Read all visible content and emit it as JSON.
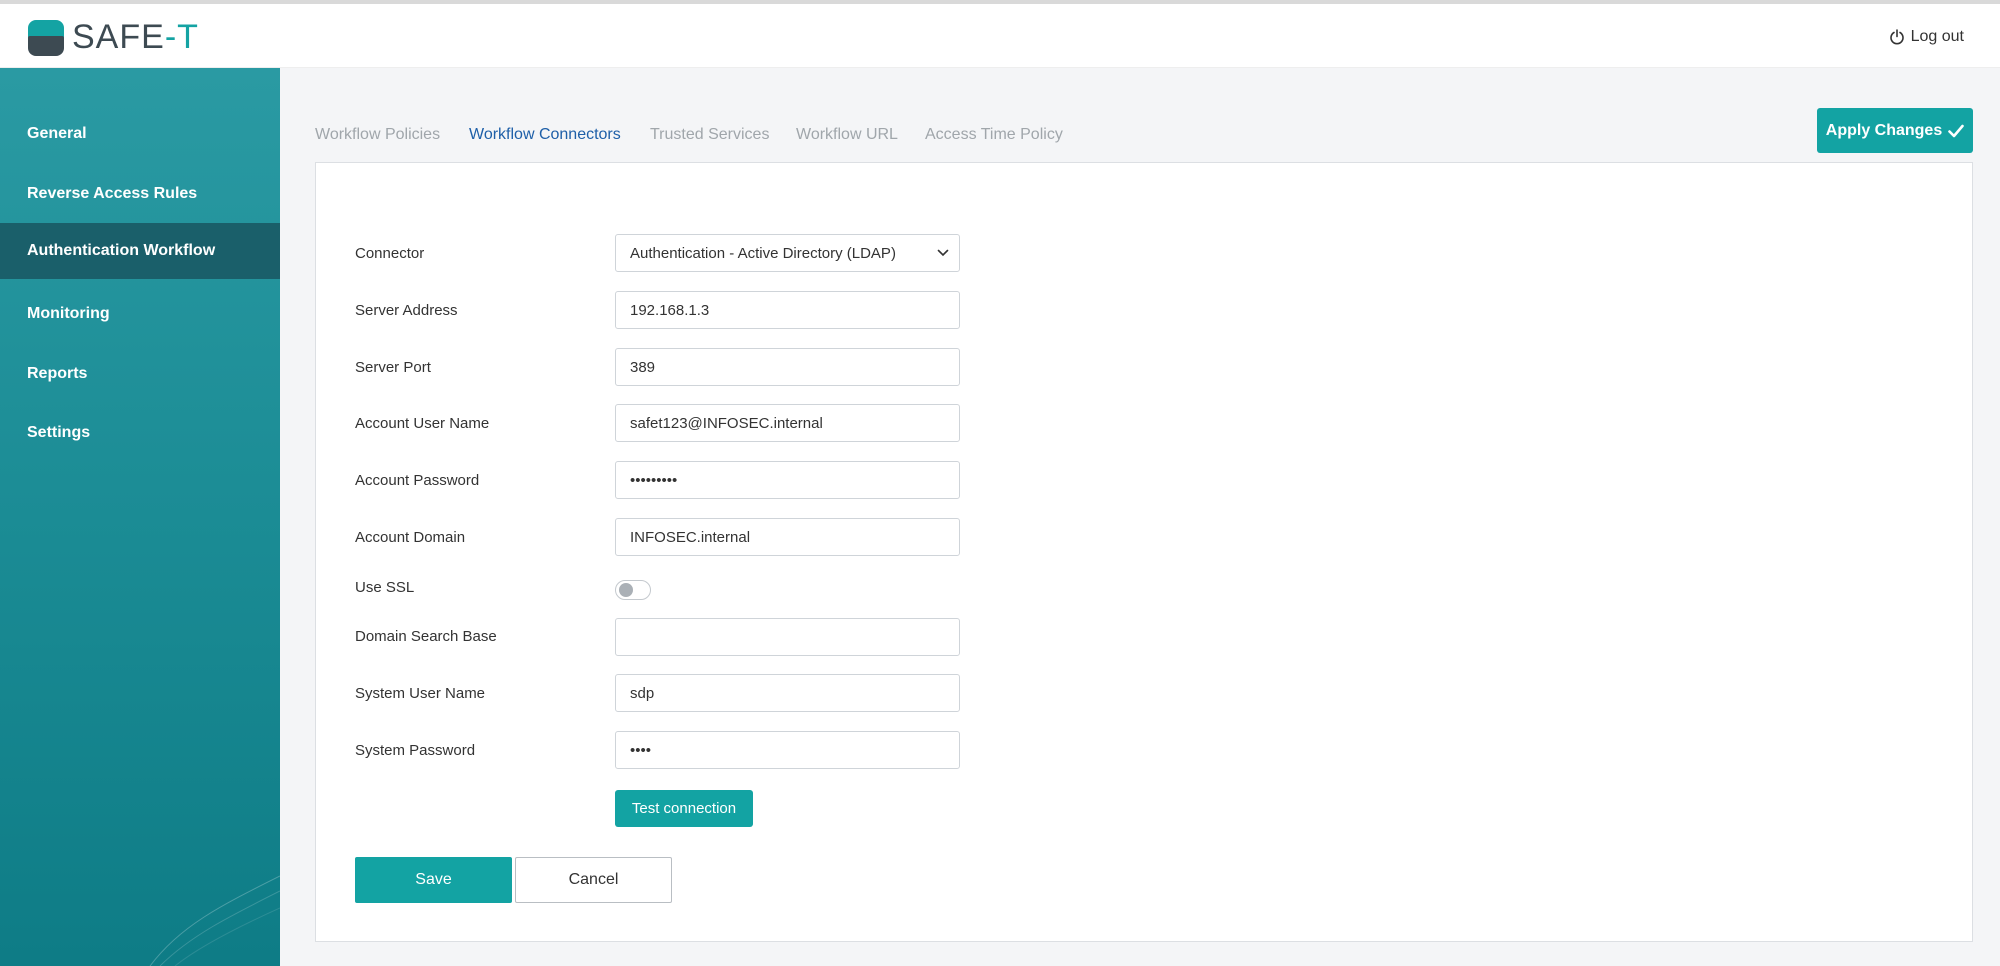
{
  "app": {
    "logo_text_a": "SAFE",
    "logo_text_b": "-T",
    "logout_label": "Log out"
  },
  "sidebar": {
    "items": [
      {
        "label": "General"
      },
      {
        "label": "Reverse Access Rules"
      },
      {
        "label": "Authentication Workflow"
      },
      {
        "label": "Monitoring"
      },
      {
        "label": "Reports"
      },
      {
        "label": "Settings"
      }
    ],
    "active": "Authentication Workflow"
  },
  "tabs": {
    "items": [
      {
        "label": "Workflow Policies"
      },
      {
        "label": "Workflow Connectors"
      },
      {
        "label": "Trusted Services"
      },
      {
        "label": "Workflow URL"
      },
      {
        "label": "Access Time Policy"
      }
    ],
    "active": "Workflow Connectors"
  },
  "toolbar": {
    "apply_label": "Apply Changes"
  },
  "form": {
    "connector": {
      "label": "Connector",
      "value": "Authentication - Active Directory (LDAP)"
    },
    "server_address": {
      "label": "Server Address",
      "value": "192.168.1.3"
    },
    "server_port": {
      "label": "Server Port",
      "value": "389"
    },
    "account_user_name": {
      "label": "Account User Name",
      "value": "safet123@INFOSEC.internal"
    },
    "account_password": {
      "label": "Account Password",
      "value": "•••••••••"
    },
    "account_domain": {
      "label": "Account Domain",
      "value": "INFOSEC.internal"
    },
    "use_ssl": {
      "label": "Use SSL",
      "checked": false
    },
    "domain_search_base": {
      "label": "Domain Search Base",
      "value": ""
    },
    "system_user_name": {
      "label": "System User Name",
      "value": "sdp"
    },
    "system_password": {
      "label": "System Password",
      "value": "••••"
    },
    "test_connection_label": "Test connection",
    "save_label": "Save",
    "cancel_label": "Cancel"
  },
  "colors": {
    "accent": "#13a3a3",
    "sidebar_active": "#1a5f6a",
    "tab_active": "#1e5fa8"
  }
}
